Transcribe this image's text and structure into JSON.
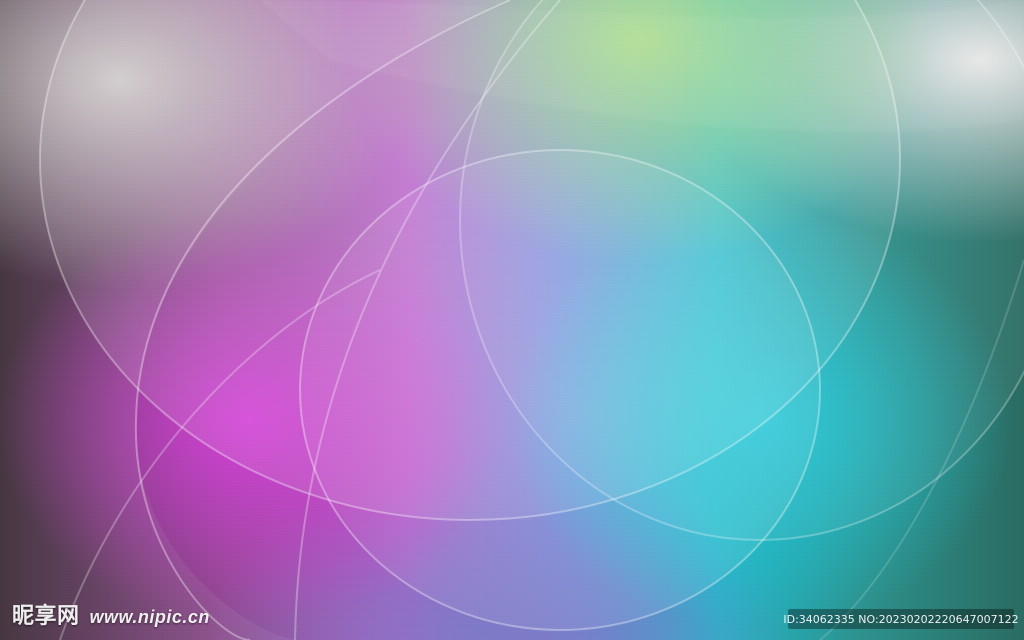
{
  "watermark": {
    "site_name": "昵享网",
    "site_url": "www.nipic.cn"
  },
  "badge": {
    "id_text": "ID:34062335 NO:20230202220647007122"
  },
  "colors": {
    "green": "#9fd67a",
    "magenta": "#d23fd6",
    "cyan": "#22c6d6",
    "lavender": "#b97be0",
    "teal_dark": "#2a6b62"
  }
}
